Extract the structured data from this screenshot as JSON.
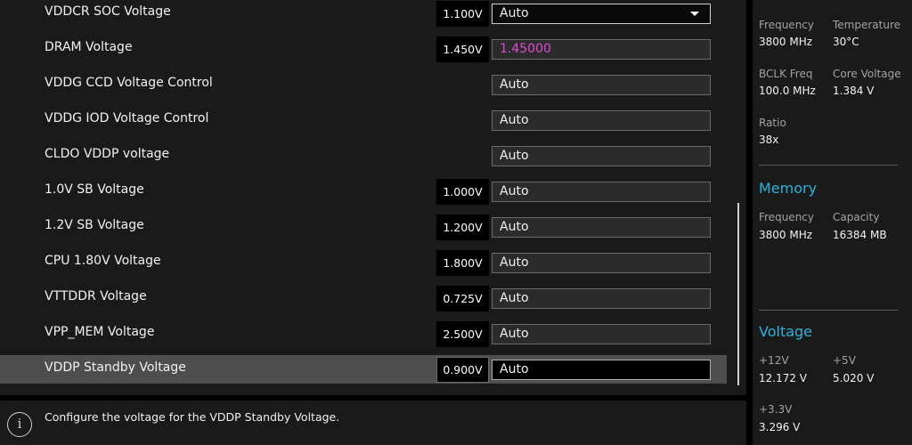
{
  "settings": [
    {
      "label": "VDDCR SOC Voltage",
      "value": "1.100V",
      "field": "Auto",
      "field_type": "dropdown"
    },
    {
      "label": "DRAM Voltage",
      "value": "1.450V",
      "field": "1.45000",
      "field_type": "highlight"
    },
    {
      "label": "VDDG CCD Voltage Control",
      "value": "",
      "field": "Auto",
      "field_type": "text"
    },
    {
      "label": "VDDG IOD Voltage Control",
      "value": "",
      "field": "Auto",
      "field_type": "text"
    },
    {
      "label": "CLDO VDDP voltage",
      "value": "",
      "field": "Auto",
      "field_type": "text"
    },
    {
      "label": "1.0V SB Voltage",
      "value": "1.000V",
      "field": "Auto",
      "field_type": "text"
    },
    {
      "label": "1.2V SB Voltage",
      "value": "1.200V",
      "field": "Auto",
      "field_type": "text"
    },
    {
      "label": "CPU 1.80V Voltage",
      "value": "1.800V",
      "field": "Auto",
      "field_type": "text"
    },
    {
      "label": "VTTDDR Voltage",
      "value": "0.725V",
      "field": "Auto",
      "field_type": "text"
    },
    {
      "label": "VPP_MEM Voltage",
      "value": "2.500V",
      "field": "Auto",
      "field_type": "text"
    },
    {
      "label": "VDDP Standby Voltage",
      "value": "0.900V",
      "field": "Auto",
      "field_type": "text",
      "selected": true
    }
  ],
  "help": {
    "icon": "info-icon",
    "text": "Configure the voltage for the VDDP Standby Voltage."
  },
  "sidebar": {
    "cpu": {
      "frequency_label": "Frequency",
      "frequency": "3800 MHz",
      "temperature_label": "Temperature",
      "temperature": "30°C",
      "bclk_label": "BCLK Freq",
      "bclk": "100.0 MHz",
      "core_voltage_label": "Core Voltage",
      "core_voltage": "1.384 V",
      "ratio_label": "Ratio",
      "ratio": "38x"
    },
    "memory": {
      "title": "Memory",
      "frequency_label": "Frequency",
      "frequency": "3800 MHz",
      "capacity_label": "Capacity",
      "capacity": "16384 MB"
    },
    "voltage": {
      "title": "Voltage",
      "v12_label": "+12V",
      "v12": "12.172 V",
      "v5_label": "+5V",
      "v5": "5.020 V",
      "v33_label": "+3.3V",
      "v33": "3.296 V"
    }
  },
  "colors": {
    "accent": "#2fb2dc",
    "highlight_text": "#e24ad6",
    "selected_row": "#4e4e4e"
  }
}
